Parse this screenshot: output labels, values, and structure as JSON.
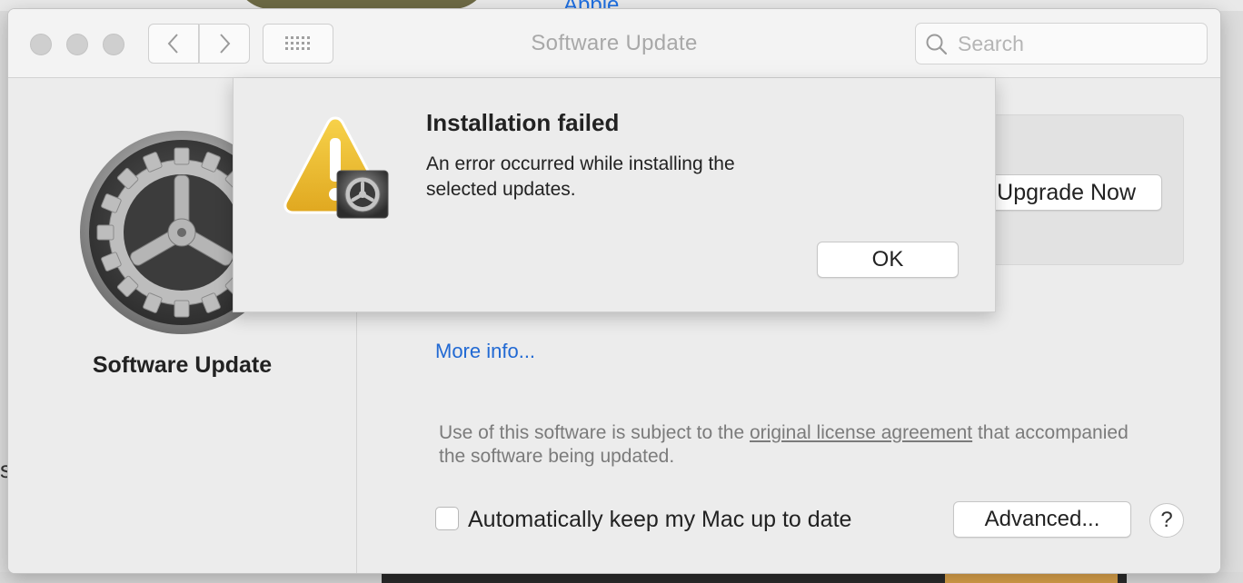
{
  "background": {
    "peek_link": "Apple",
    "peek_side_text": "s"
  },
  "window": {
    "title": "Software Update",
    "search": {
      "placeholder": "Search",
      "value": ""
    },
    "icons": {
      "back": "chevron-left-icon",
      "forward": "chevron-right-icon",
      "grid": "grid-icon",
      "search": "search-icon"
    }
  },
  "sidebar": {
    "title": "Software Update",
    "icon": "software-update-gear-icon"
  },
  "content": {
    "upgrade_button": "Upgrade Now",
    "more_info": "More info...",
    "license_prefix": "Use of this software is subject to the ",
    "license_link": "original license agreement",
    "license_suffix": " that accompanied the software being updated.",
    "auto_update_label": "Automatically keep my Mac up to date",
    "auto_update_checked": false,
    "advanced_button": "Advanced...",
    "help_button": "?"
  },
  "alert": {
    "title": "Installation failed",
    "message": "An error occurred while installing the selected updates.",
    "ok_button": "OK",
    "icon": "warning-icon"
  },
  "colors": {
    "link": "#2169d3",
    "window_bg": "#ececec",
    "warning_yellow": "#f2c12e"
  }
}
